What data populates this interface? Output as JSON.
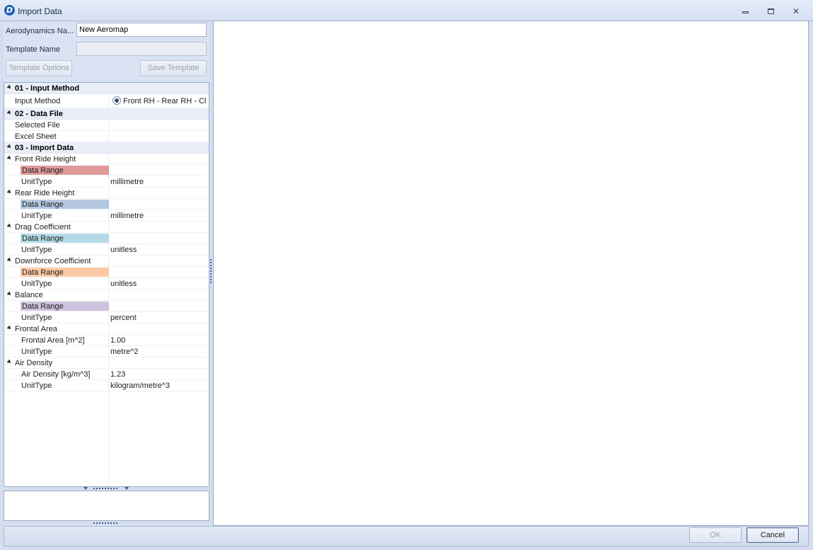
{
  "window": {
    "title": "Import Data",
    "icon": "app-logo-icon",
    "controls": {
      "minimize": "minimize-icon",
      "maximize": "maximize-icon",
      "close": "close-icon"
    }
  },
  "form": {
    "aero_name_label": "Aerodynamics Na...",
    "aero_name_value": "New Aeromap",
    "template_name_label": "Template Name",
    "template_name_value": "",
    "template_options_label": "Template Options",
    "save_template_label": "Save Template"
  },
  "grid": {
    "cat_input_method": "01 - Input Method",
    "input_method_name": "Input Method",
    "input_method_value": "Front RH - Rear RH - Cl",
    "cat_data_file": "02 - Data File",
    "selected_file_name": "Selected File",
    "selected_file_value": "",
    "excel_sheet_name": "Excel Sheet",
    "excel_sheet_value": "",
    "cat_import_data": "03 - Import Data",
    "front_ride_height": "Front Ride Height",
    "rear_ride_height": "Rear Ride Height",
    "drag_coefficient": "Drag Coefficient",
    "downforce_coefficient": "Downforce Coefficient",
    "balance": "Balance",
    "frontal_area_group": "Frontal Area",
    "air_density_group": "Air Density",
    "data_range": "Data Range",
    "unit_type": "UnitType",
    "unit_millimetre": "millimetre",
    "unit_unitless": "unitless",
    "unit_percent": "percent",
    "frontal_area_name": "Frontal Area [m^2]",
    "frontal_area_value": "1.00",
    "frontal_area_unit": "metre^2",
    "air_density_name": "Air Density [kg/m^3]",
    "air_density_value": "1.23",
    "air_density_unit": "kilogram/metre^3"
  },
  "colors": {
    "front_ride_height_range": "#e09a9a",
    "rear_ride_height_range": "#b4c7df",
    "drag_coefficient_range": "#b2dae6",
    "downforce_coefficient_range": "#fcc9a4",
    "balance_range": "#cfc2dd"
  },
  "footer": {
    "ok_label": "OK",
    "cancel_label": "Cancel"
  }
}
